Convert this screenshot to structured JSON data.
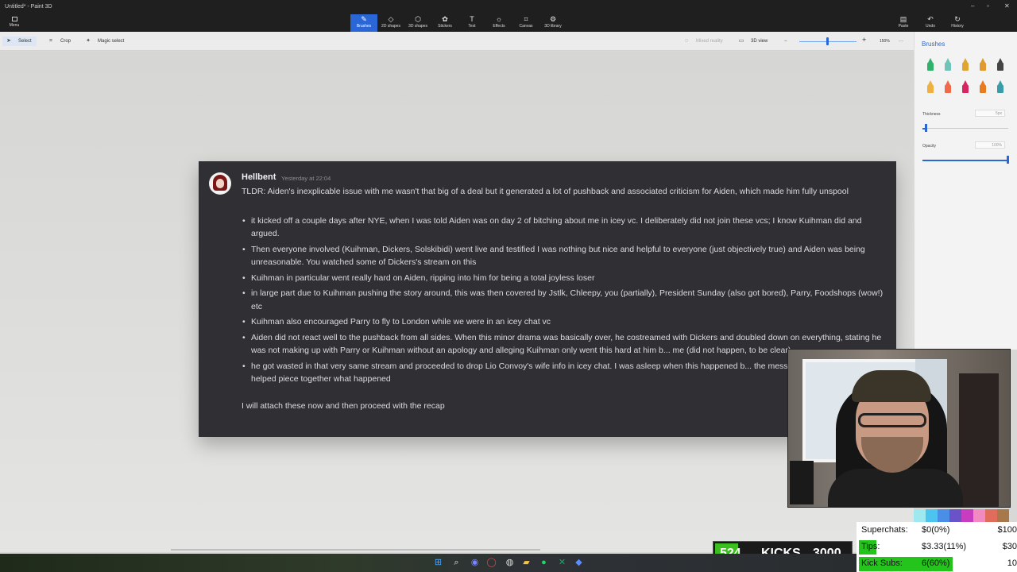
{
  "window": {
    "title": "Untitled* - Paint 3D"
  },
  "ribbon": {
    "menu_label": "Menu",
    "tabs": [
      {
        "label": "Brushes",
        "icon": "brush-icon",
        "glyph": "✎"
      },
      {
        "label": "2D shapes",
        "icon": "shapes-2d-icon",
        "glyph": "◇"
      },
      {
        "label": "3D shapes",
        "icon": "shapes-3d-icon",
        "glyph": "⬡"
      },
      {
        "label": "Stickers",
        "icon": "sticker-icon",
        "glyph": "✿"
      },
      {
        "label": "Text",
        "icon": "text-icon",
        "glyph": "T"
      },
      {
        "label": "Effects",
        "icon": "effects-icon",
        "glyph": "☼"
      },
      {
        "label": "Canvas",
        "icon": "canvas-icon",
        "glyph": "⌗"
      },
      {
        "label": "3D library",
        "icon": "library-icon",
        "glyph": "⚙"
      }
    ],
    "actions": [
      {
        "label": "Paste",
        "icon": "paste-icon",
        "glyph": "▤"
      },
      {
        "label": "Undo",
        "icon": "undo-icon",
        "glyph": "↶"
      },
      {
        "label": "History",
        "icon": "history-icon",
        "glyph": "↻"
      }
    ]
  },
  "toolbar": {
    "select_label": "Select",
    "crop_label": "Crop",
    "magic_select_label": "Magic select",
    "mixed_reality_label": "Mixed reality",
    "view3d_label": "3D view",
    "zoom_label": "150%",
    "zoom_percent": 150
  },
  "panel": {
    "title": "Brushes",
    "thickness_label": "Thickness",
    "thickness_value": "5px",
    "opacity_label": "Opacity",
    "opacity_value": "100%",
    "thickness_fraction": 0.05,
    "opacity_fraction": 1.0,
    "brush_colors": [
      "#2fb36a",
      "#6fc3b8",
      "#e0a530",
      "#e09a30",
      "#444444",
      "#f0b040",
      "#f06a4a",
      "#d8245f",
      "#e87a20",
      "#3a9ca8"
    ]
  },
  "message": {
    "author": "Hellbent",
    "timestamp": "Yesterday at 22:04",
    "tldr": "TLDR: Aiden's inexplicable issue with me wasn't that big of a deal but it generated a lot of pushback and associated criticism for Aiden, which made him fully unspool",
    "bullets": [
      "it kicked off a couple days after NYE, when I was told Aiden was on day 2 of bitching about me in icey vc. I deliberately did not join these vcs; I know Kuihman did and argued.",
      "Then everyone involved (Kuihman, Dickers, Solskibidi) went live and testified I was nothing but nice and helpful to everyone (just objectively true) and Aiden was being unreasonable. You watched some of Dickers's stream on this",
      "Kuihman in particular went really hard on Aiden, ripping into him for being a total joyless loser",
      "in large part due to Kuihman pushing the story around, this was then covered by Jstlk, Chleepy, you (partially), President Sunday (also got bored), Parry, Foodshops (wow!) etc",
      "Kuihman also encouraged Parry to fly to London while we were in an icey chat vc",
      "Aiden did not react well to the pushback from all sides. When this minor drama was basically over, he costreamed with Dickers and doubled down on everything, stating he was not making up with Parry or Kuihman without an apology and alleging Kuihman only went this hard at him b... me (did not happen, to be clear)",
      "he got wasted in that very same stream and proceeded to drop Lio Convoy's wife info in icey chat. I was asleep when this happened b... the messages that remained and helped piece together what happened"
    ],
    "closing": "I will attach these now and then proceed with the recap"
  },
  "overlay": {
    "kicks": {
      "count": "524",
      "label": "KICKS",
      "goal": "3000",
      "fraction": 0.17
    },
    "stats": [
      {
        "label": "Superchats:",
        "current": "$0(0%)",
        "goal": "$100",
        "fraction": 0.0
      },
      {
        "label": "Tips:",
        "current": "$3.33(11%)",
        "goal": "$30",
        "fraction": 0.11
      },
      {
        "label": "Kick Subs:",
        "current": "6(60%)",
        "goal": "10",
        "fraction": 0.6
      }
    ],
    "swatches": [
      "#9ee8f0",
      "#4cc4f0",
      "#4a8ee8",
      "#6a52c8",
      "#c83cc0",
      "#f08ac0",
      "#e06c5c",
      "#a8784a"
    ]
  },
  "taskbar": {
    "apps": [
      {
        "icon": "windows-start-icon",
        "glyph": "⊞",
        "color": "#4aa3ff"
      },
      {
        "icon": "search-icon",
        "glyph": "⌕",
        "color": "#e6e6e6"
      },
      {
        "icon": "discord-icon",
        "glyph": "◉",
        "color": "#7a86ff"
      },
      {
        "icon": "opera-icon",
        "glyph": "◯",
        "color": "#ff3a3a"
      },
      {
        "icon": "obs-icon",
        "glyph": "◍",
        "color": "#dddddd"
      },
      {
        "icon": "spotify-icon",
        "glyph": "●",
        "color": "#1ed760"
      },
      {
        "icon": "file-explorer-icon",
        "glyph": "▰",
        "color": "#f5c24a"
      },
      {
        "icon": "excel-icon",
        "glyph": "✕",
        "color": "#21a366"
      },
      {
        "icon": "paint3d-icon",
        "glyph": "◆",
        "color": "#5a8cff"
      }
    ]
  }
}
